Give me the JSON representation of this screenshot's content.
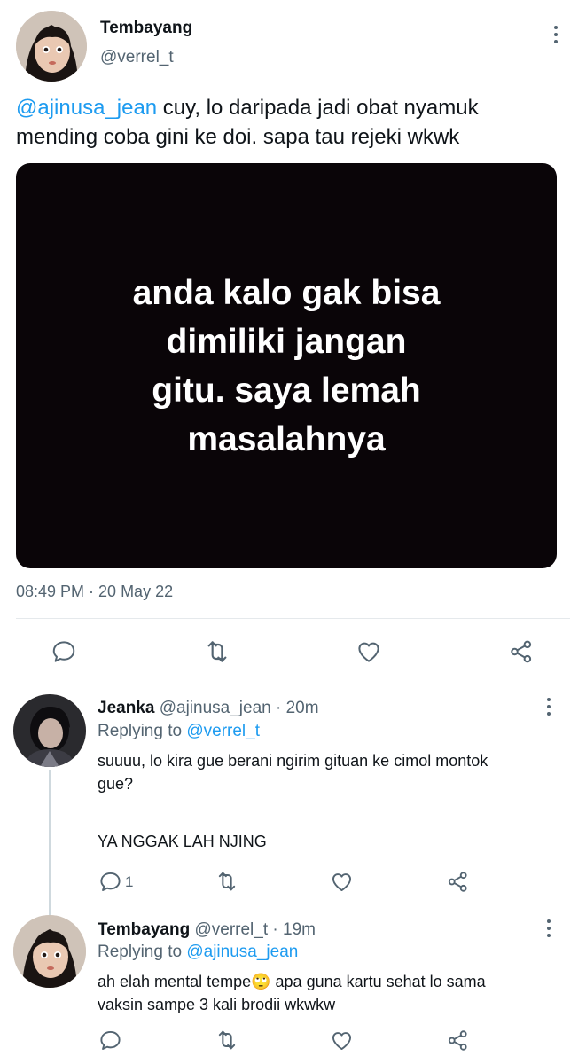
{
  "main_tweet": {
    "author_name": "Tembayang",
    "handle": "@verrel_t",
    "mention": "@ajinusa_jean",
    "text": " cuy, lo daripada jadi obat nyamuk mending coba gini ke doi. sapa tau rejeki wkwk",
    "media_text": "anda kalo gak bisa\ndimiliki jangan\ngitu. saya lemah\nmasalahnya",
    "timestamp": "08:49 PM · 20 May 22",
    "actions": [
      "reply-icon",
      "retweet-icon",
      "like-icon",
      "share-icon"
    ]
  },
  "replies": [
    {
      "name": "Jeanka",
      "meta": "@ajinusa_jean · 20m",
      "replying_prefix": "Replying to ",
      "replying_to": "@verrel_t",
      "text_lines": [
        "suuuu, lo kira gue berani ngirim gituan ke cimol montok",
        "gue?"
      ],
      "text_extra": "YA NGGAK LAH NJING",
      "reply_count": "1"
    },
    {
      "name": "Tembayang",
      "meta": "@verrel_t · 19m",
      "replying_prefix": "Replying to ",
      "replying_to": "@ajinusa_jean",
      "text_line1": "ah elah mental tempe",
      "emoji": "🙄",
      "text_line1_end": " apa guna kartu sehat lo sama",
      "text_line2": "vaksin sampe 3 kali brodii wkwkw",
      "reply_count": ""
    }
  ],
  "colors": {
    "accent": "#1d9bf0",
    "secondary_text": "#536471",
    "primary_text": "#0f1419",
    "media_bg": "#0a0508"
  }
}
